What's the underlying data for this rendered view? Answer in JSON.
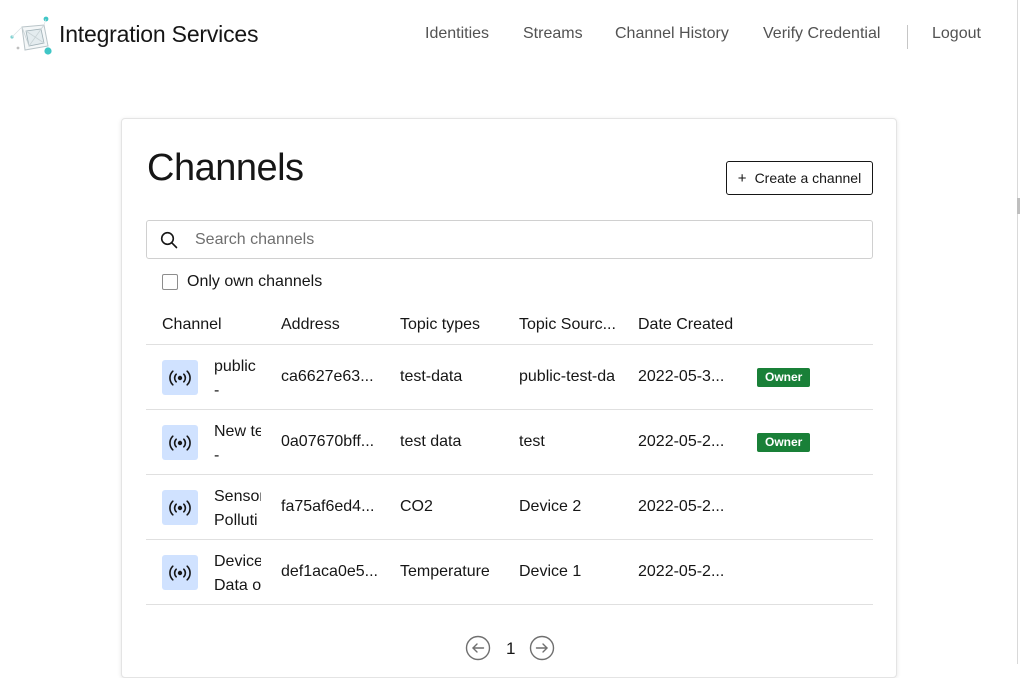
{
  "app": {
    "brand": "Integration Services"
  },
  "nav": {
    "identities": "Identities",
    "streams": "Streams",
    "channel_history": "Channel History",
    "verify_credential": "Verify Credential",
    "logout": "Logout"
  },
  "page": {
    "title": "Channels",
    "create_label": "Create a channel",
    "search_placeholder": "Search channels",
    "search_value": "",
    "filter_label": "Only own channels",
    "filter_checked": false
  },
  "table": {
    "headers": {
      "channel": "Channel",
      "address": "Address",
      "topic_types": "Topic types",
      "topic_source": "Topic Sourc...",
      "date_created": "Date Created"
    },
    "rows": [
      {
        "name_line1": "public",
        "name_line2": "-",
        "address": "ca6627e63...",
        "topic_types": "test-data",
        "topic_source": "public-test-da",
        "date": "2022-05-3...",
        "badge": "Owner"
      },
      {
        "name_line1": "New te",
        "name_line2": "-",
        "address": "0a07670bff...",
        "topic_types": "test data",
        "topic_source": "test",
        "date": "2022-05-2...",
        "badge": "Owner"
      },
      {
        "name_line1": "Sensor",
        "name_line2": "Polluti",
        "address": "fa75af6ed4...",
        "topic_types": "CO2",
        "topic_source": "Device 2",
        "date": "2022-05-2...",
        "badge": ""
      },
      {
        "name_line1": "Device",
        "name_line2": "Data o",
        "address": "def1aca0e5...",
        "topic_types": "Temperature",
        "topic_source": "Device 1",
        "date": "2022-05-2...",
        "badge": ""
      }
    ]
  },
  "pagination": {
    "current_page": "1"
  },
  "icons": {
    "logo": "integration-services-logo",
    "channel": "broadcast-icon",
    "search": "search-icon",
    "create": "plus-icon",
    "prev": "arrow-left-circle-icon",
    "next": "arrow-right-circle-icon"
  },
  "colors": {
    "owner_badge": "#198038",
    "channel_icon_bg": "#d0e2ff",
    "logo_accent": "#3fc6c6"
  }
}
